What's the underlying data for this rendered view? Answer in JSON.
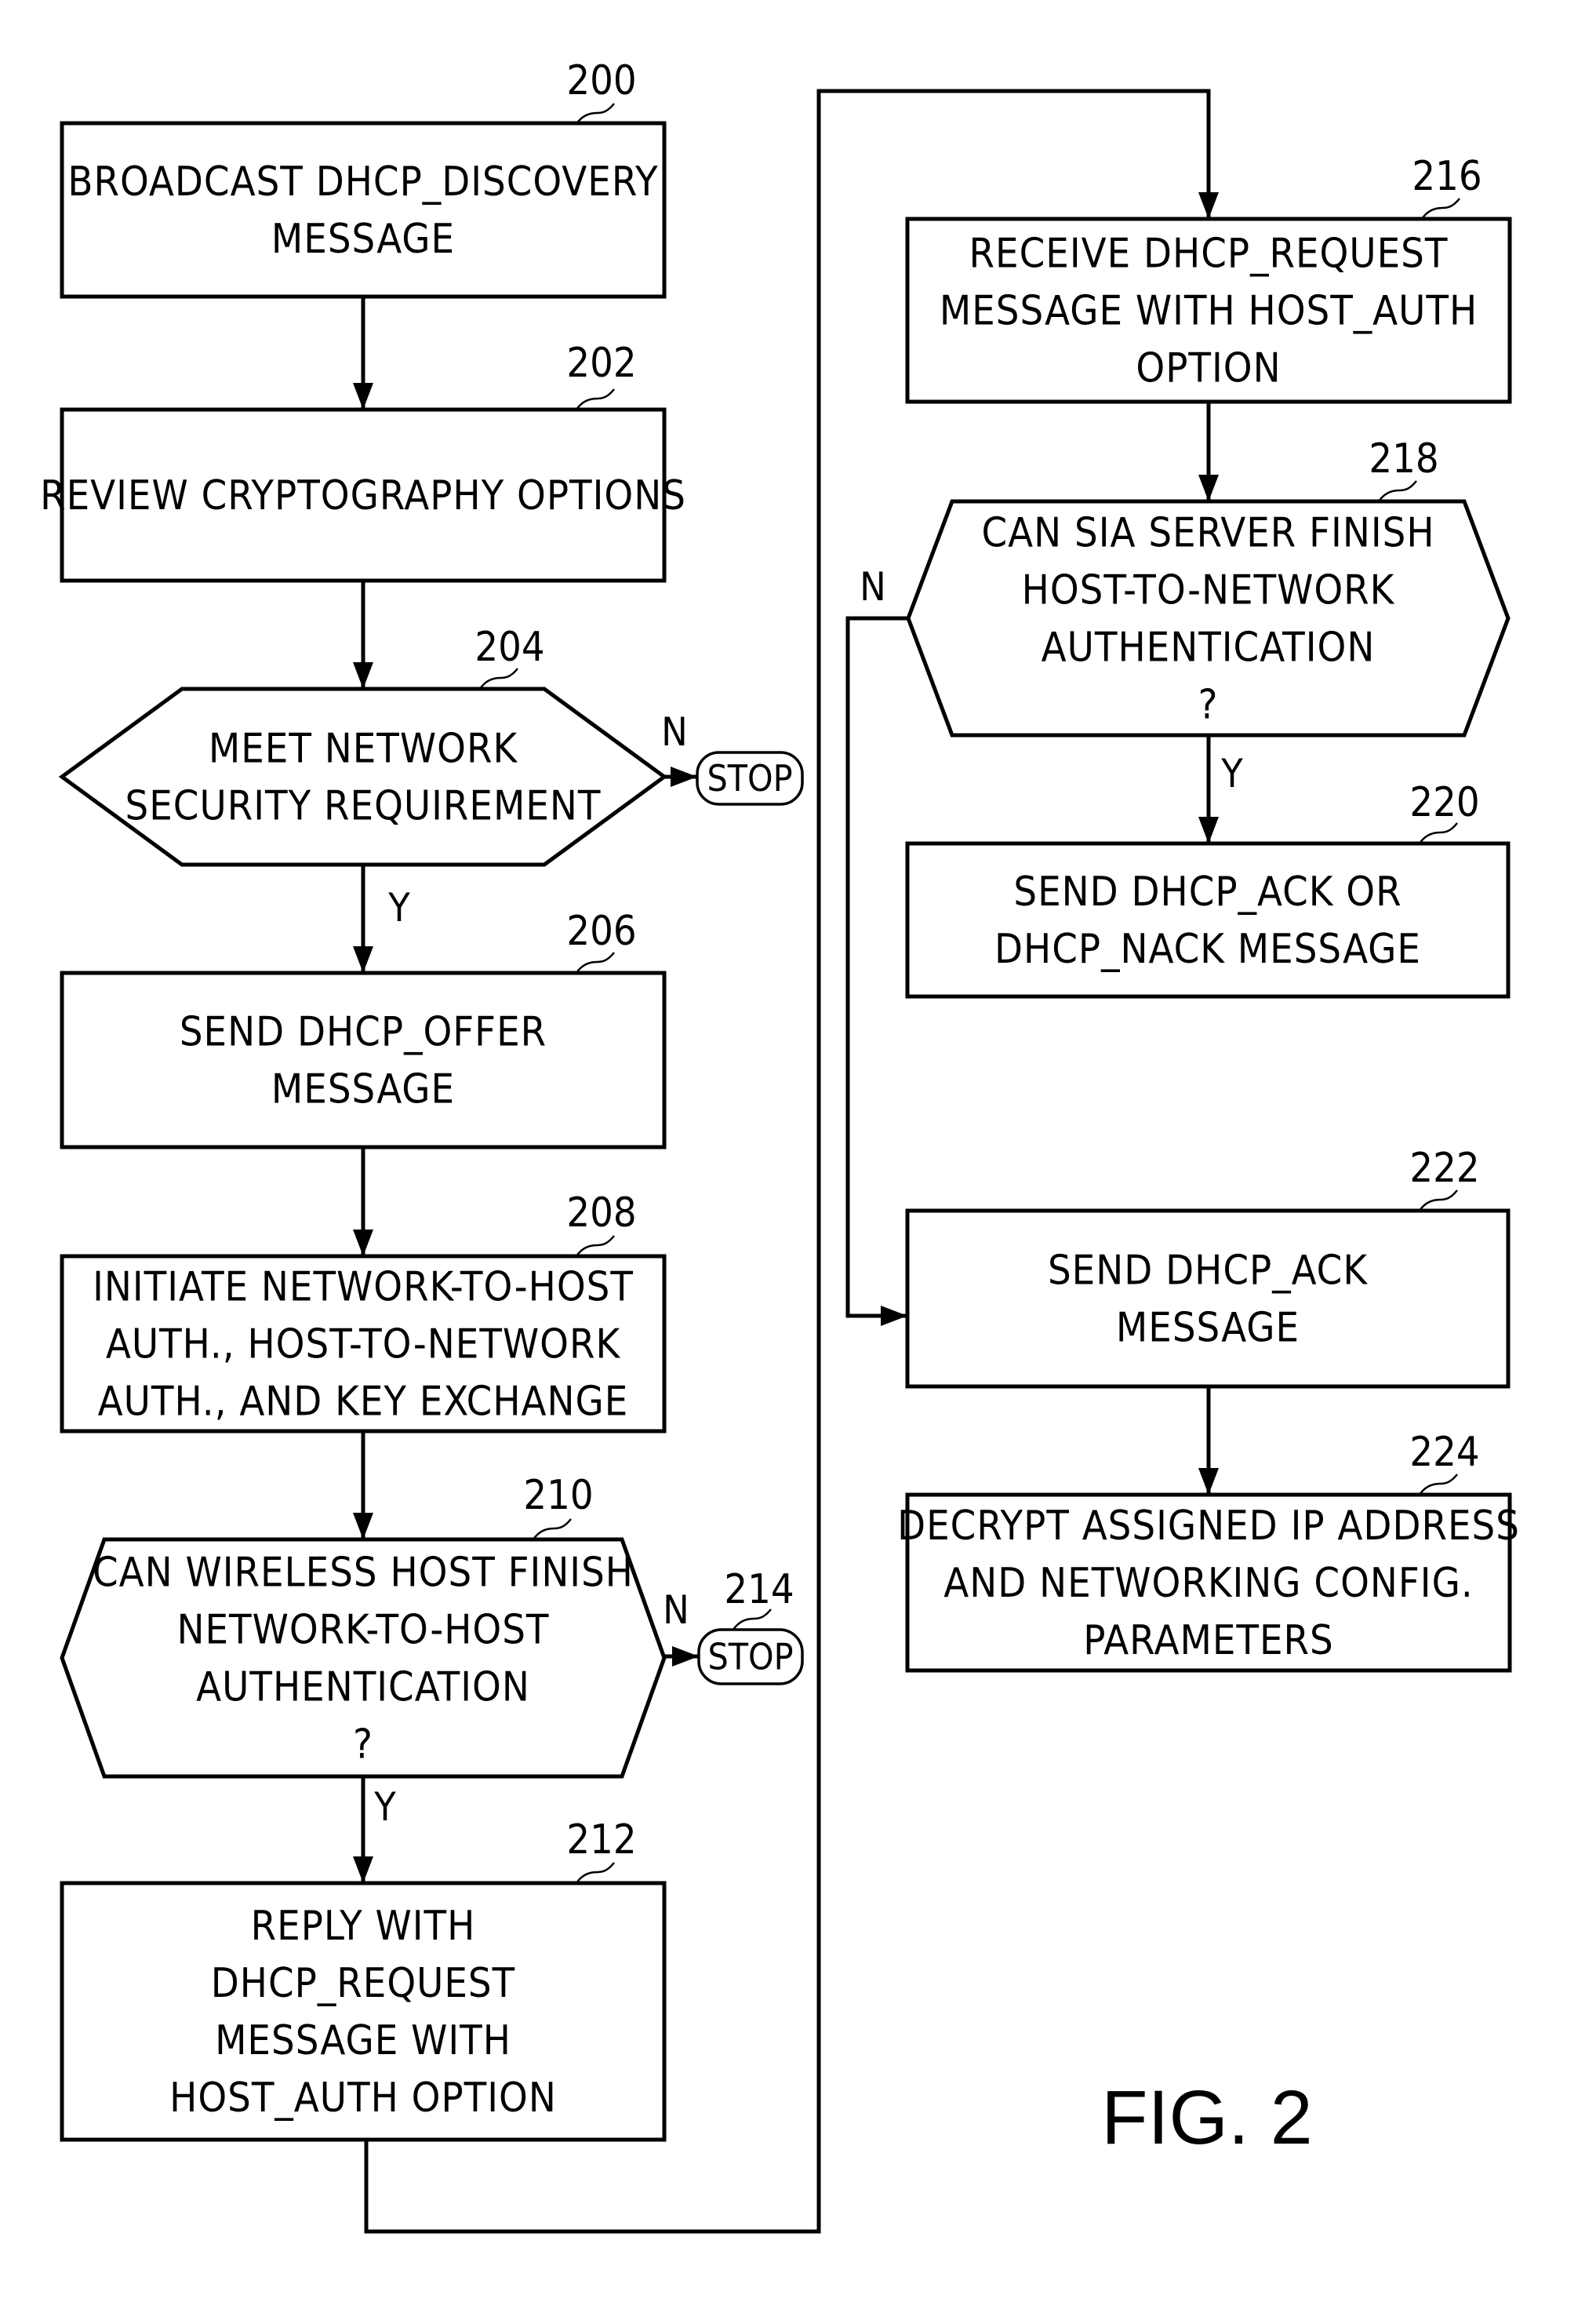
{
  "figure": {
    "label": "FIG. 2",
    "type": "flowchart"
  },
  "nodes": [
    {
      "id": "200",
      "kind": "process",
      "lines": [
        "BROADCAST DHCP_DISCOVERY",
        "MESSAGE"
      ]
    },
    {
      "id": "202",
      "kind": "process",
      "lines": [
        "REVIEW CRYPTOGRAPHY OPTIONS"
      ]
    },
    {
      "id": "204",
      "kind": "decision",
      "lines": [
        "MEET NETWORK",
        "SECURITY REQUIREMENT"
      ]
    },
    {
      "id": "206",
      "kind": "process",
      "lines": [
        "SEND DHCP_OFFER",
        "MESSAGE"
      ]
    },
    {
      "id": "208",
      "kind": "process",
      "lines": [
        "INITIATE NETWORK-TO-HOST",
        "AUTH., HOST-TO-NETWORK",
        "AUTH., AND KEY EXCHANGE"
      ]
    },
    {
      "id": "210",
      "kind": "decision",
      "lines": [
        "CAN WIRELESS HOST FINISH",
        "NETWORK-TO-HOST",
        "AUTHENTICATION",
        "?"
      ]
    },
    {
      "id": "212",
      "kind": "process",
      "lines": [
        "REPLY WITH",
        "DHCP_REQUEST",
        "MESSAGE WITH",
        "HOST_AUTH OPTION"
      ]
    },
    {
      "id": "214",
      "kind": "terminal",
      "lines": [
        "STOP"
      ]
    },
    {
      "id": "216",
      "kind": "process",
      "lines": [
        "RECEIVE DHCP_REQUEST",
        "MESSAGE WITH HOST_AUTH",
        "OPTION"
      ]
    },
    {
      "id": "218",
      "kind": "decision",
      "lines": [
        "CAN SIA SERVER FINISH",
        "HOST-TO-NETWORK",
        "AUTHENTICATION",
        "?"
      ]
    },
    {
      "id": "220",
      "kind": "process",
      "lines": [
        "SEND DHCP_ACK OR",
        "DHCP_NACK MESSAGE"
      ]
    },
    {
      "id": "222",
      "kind": "process",
      "lines": [
        "SEND DHCP_ACK",
        "MESSAGE"
      ]
    },
    {
      "id": "224",
      "kind": "process",
      "lines": [
        "DECRYPT ASSIGNED IP ADDRESS",
        "AND NETWORKING CONFIG.",
        "PARAMETERS"
      ]
    }
  ],
  "unnumbered_terminals": [
    {
      "id": "stop-204",
      "lines": [
        "STOP"
      ]
    }
  ],
  "edges": [
    {
      "from": "200",
      "to": "202",
      "label": ""
    },
    {
      "from": "202",
      "to": "204",
      "label": ""
    },
    {
      "from": "204",
      "to": "stop-204",
      "label": "N"
    },
    {
      "from": "204",
      "to": "206",
      "label": "Y"
    },
    {
      "from": "206",
      "to": "208",
      "label": ""
    },
    {
      "from": "208",
      "to": "210",
      "label": ""
    },
    {
      "from": "210",
      "to": "214",
      "label": "N"
    },
    {
      "from": "210",
      "to": "212",
      "label": "Y"
    },
    {
      "from": "212",
      "to": "216",
      "label": ""
    },
    {
      "from": "216",
      "to": "218",
      "label": ""
    },
    {
      "from": "218",
      "to": "220",
      "label": "Y"
    },
    {
      "from": "218",
      "to": "222",
      "label": "N"
    },
    {
      "from": "222",
      "to": "224",
      "label": ""
    }
  ]
}
